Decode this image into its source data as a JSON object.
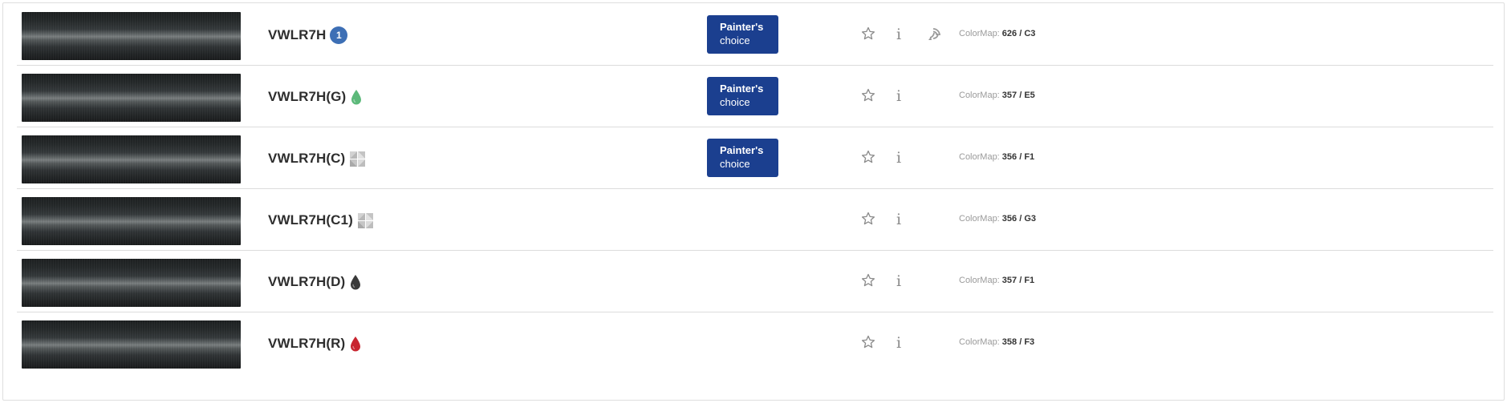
{
  "rows": [
    {
      "code": "VWLR7H",
      "marker": "number",
      "marker_value": "1",
      "painters_choice": true,
      "signal": true,
      "colormap_label": "ColorMap:",
      "colormap_value": "626 / C3"
    },
    {
      "code": "VWLR7H(G)",
      "marker": "drop",
      "marker_color": "#5cb97a",
      "painters_choice": true,
      "signal": false,
      "colormap_label": "ColorMap:",
      "colormap_value": "357 / E5"
    },
    {
      "code": "VWLR7H(C)",
      "marker": "triangles",
      "painters_choice": true,
      "signal": false,
      "colormap_label": "ColorMap:",
      "colormap_value": "356 / F1"
    },
    {
      "code": "VWLR7H(C1)",
      "marker": "triangles",
      "painters_choice": false,
      "signal": false,
      "colormap_label": "ColorMap:",
      "colormap_value": "356 / G3"
    },
    {
      "code": "VWLR7H(D)",
      "marker": "drop",
      "marker_color": "#3a3a3a",
      "painters_choice": false,
      "signal": false,
      "colormap_label": "ColorMap:",
      "colormap_value": "357 / F1"
    },
    {
      "code": "VWLR7H(R)",
      "marker": "drop",
      "marker_color": "#c8242f",
      "painters_choice": false,
      "signal": false,
      "colormap_label": "ColorMap:",
      "colormap_value": "358 / F3"
    }
  ],
  "painters_choice": {
    "line1": "Painter's",
    "line2": "choice"
  },
  "icons": {
    "favorite": "star-outline-icon",
    "info": "info-icon",
    "signal": "signal-icon"
  },
  "colors": {
    "accent": "#1b3f8f",
    "badge": "#3d6fb5"
  }
}
